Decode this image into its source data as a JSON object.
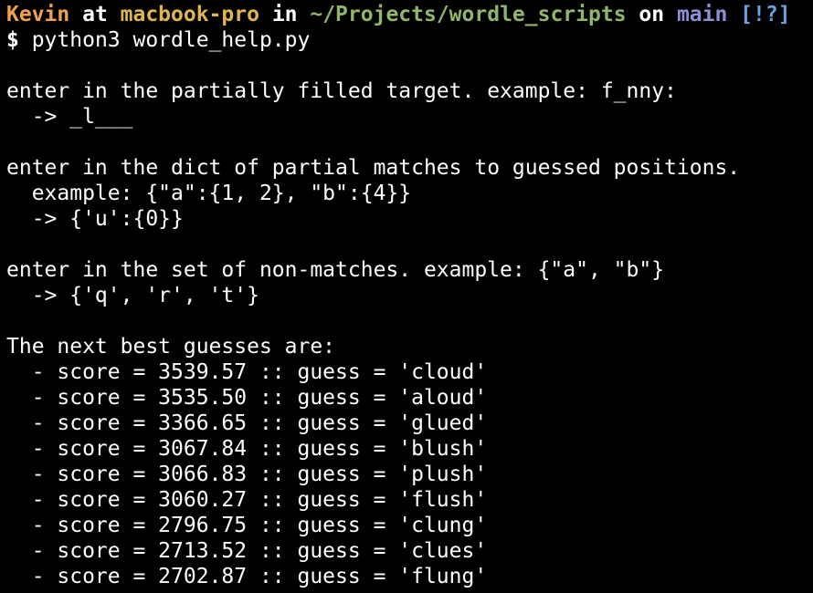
{
  "prompt": {
    "user": "Kevin",
    "at": " at ",
    "host": "macbook-pro",
    "in": " in ",
    "path": "~/Projects/wordle_scripts",
    "on": " on ",
    "branch": "main",
    "status": " [!?]",
    "symbol": "$ ",
    "command": "python3 wordle_help.py"
  },
  "colors": {
    "user": "#f0a050",
    "host": "#e0b550",
    "path": "#8fb66a",
    "branch": "#8f8fd8",
    "status": "#6aa4e0",
    "text": "#ffffff",
    "background": "#000000"
  },
  "output": {
    "target_prompt": "enter in the partially filled target. example: f_nny:",
    "target_input": "  -> _l___",
    "partial_prompt": "enter in the dict of partial matches to guessed positions.",
    "partial_example": "  example: {\"a\":{1, 2}, \"b\":{4}}",
    "partial_input": "  -> {'u':{0}}",
    "nonmatch_prompt": "enter in the set of non-matches. example: {\"a\", \"b\"}",
    "nonmatch_input": "  -> {'q', 'r', 't'}",
    "guesses_header": "The next best guesses are:",
    "guesses": [
      "  - score = 3539.57 :: guess = 'cloud'",
      "  - score = 3535.50 :: guess = 'aloud'",
      "  - score = 3366.65 :: guess = 'glued'",
      "  - score = 3067.84 :: guess = 'blush'",
      "  - score = 3066.83 :: guess = 'plush'",
      "  - score = 3060.27 :: guess = 'flush'",
      "  - score = 2796.75 :: guess = 'clung'",
      "  - score = 2713.52 :: guess = 'clues'",
      "  - score = 2702.87 :: guess = 'flung'"
    ]
  }
}
